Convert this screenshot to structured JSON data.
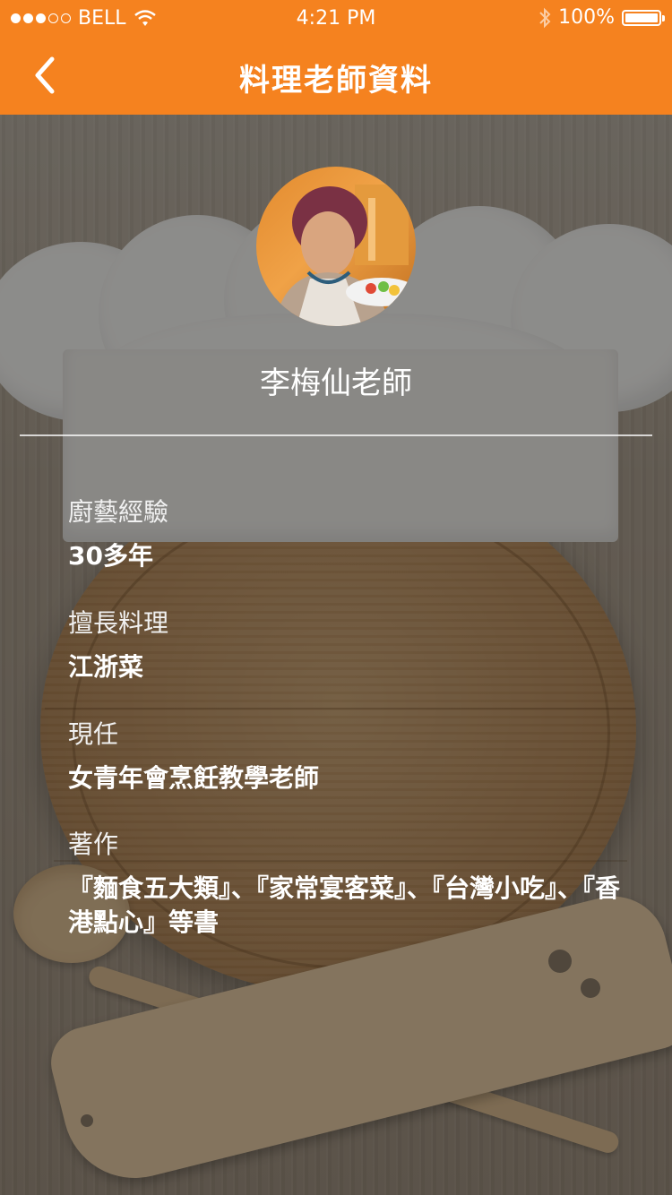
{
  "status_bar": {
    "carrier": "BELL",
    "time": "4:21 PM",
    "battery": "100%",
    "signal_level": 3,
    "signal_max": 5,
    "battery_level": 1.0
  },
  "nav": {
    "title": "料理老師資料",
    "back_icon": "chevron-left-icon"
  },
  "profile": {
    "name": "李梅仙老師"
  },
  "details": [
    {
      "label": "廚藝經驗",
      "value": "30多年"
    },
    {
      "label": "擅長料理",
      "value": "江浙菜"
    },
    {
      "label": "現任",
      "value": "女青年會烹飪教學老師"
    },
    {
      "label": "著作",
      "value": "『麵食五大類』、『家常宴客菜』、『台灣小吃』、『香港點心』等書"
    }
  ],
  "colors": {
    "accent": "#f5821f",
    "text": "#ffffff"
  }
}
